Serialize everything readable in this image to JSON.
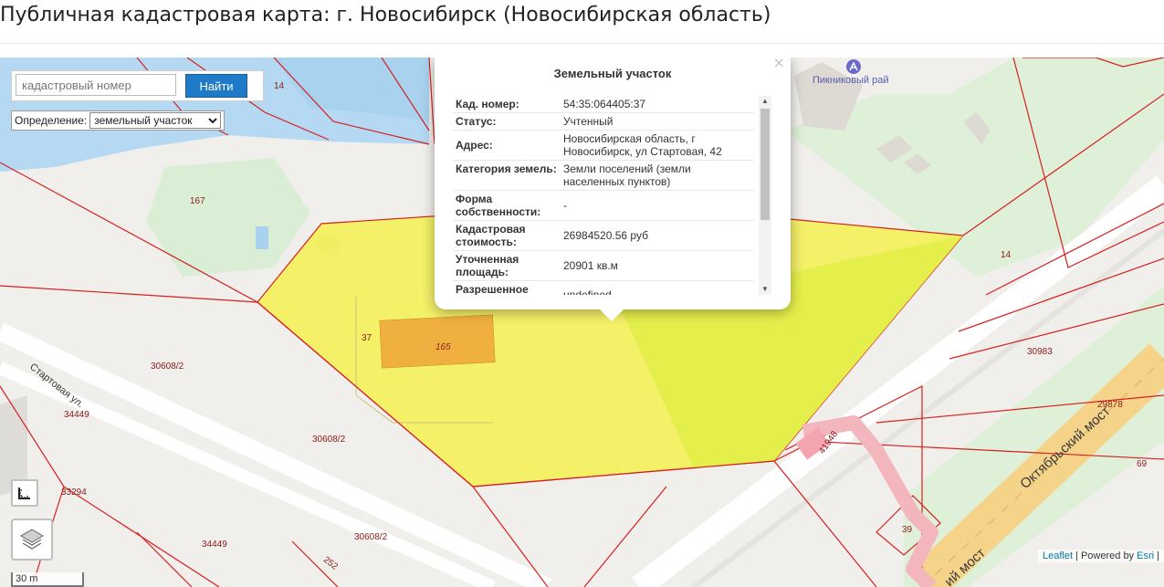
{
  "page": {
    "title": "Публичная кадастровая карта: г. Новосибирск (Новосибирская область)"
  },
  "search": {
    "placeholder": "кадастровый номер",
    "button_label": "Найти",
    "definition_label": "Определение:",
    "definition_selected": "земельный участок"
  },
  "popup": {
    "title": "Земельный участок",
    "close_glyph": "×",
    "rows": [
      {
        "key": "Кад. номер:",
        "value": "54:35:064405:37"
      },
      {
        "key": "Статус:",
        "value": "Учтенный"
      },
      {
        "key": "Адрес:",
        "value": "Новосибирская область, г Новосибирск, ул Стартовая, 42"
      },
      {
        "key": "Категория земель:",
        "value": "Земли поселений (земли населенных пунктов)"
      },
      {
        "key": "Форма собственности:",
        "value": "-"
      },
      {
        "key": "Кадастровая стоимость:",
        "value": "26984520.56 руб"
      },
      {
        "key": "Уточненная площадь:",
        "value": "20901 кв.м"
      },
      {
        "key": "Разрешенное",
        "value": "undefined"
      }
    ]
  },
  "map": {
    "plot_labels": [
      "14",
      "167",
      "37",
      "165",
      "30608/2",
      "30608/2",
      "30608/2",
      "34449",
      "34449",
      "33294",
      "252",
      "14",
      "30983",
      "29878",
      "69",
      "41948",
      "39"
    ],
    "street_labels": [
      "Стартовая ул.",
      "Октябрьский мост",
      "ий мост"
    ],
    "poi_label": "Пикниковый рай",
    "scale_label": "30 m",
    "colors": {
      "parcel_fill": "#f4f05a",
      "parcel_border": "#d61f1f",
      "building_fill": "#f0b040",
      "water": "#b5d9f2",
      "green": "#d9eed4",
      "bridge_road": "#f5d48a"
    }
  },
  "attribution": {
    "leaflet": "Leaflet",
    "separator": " | Powered by ",
    "esri": "Esri",
    "trail": " |"
  },
  "icons": {
    "ruler": "ruler-icon",
    "layers": "layers-icon",
    "poi": "picnic-icon"
  }
}
